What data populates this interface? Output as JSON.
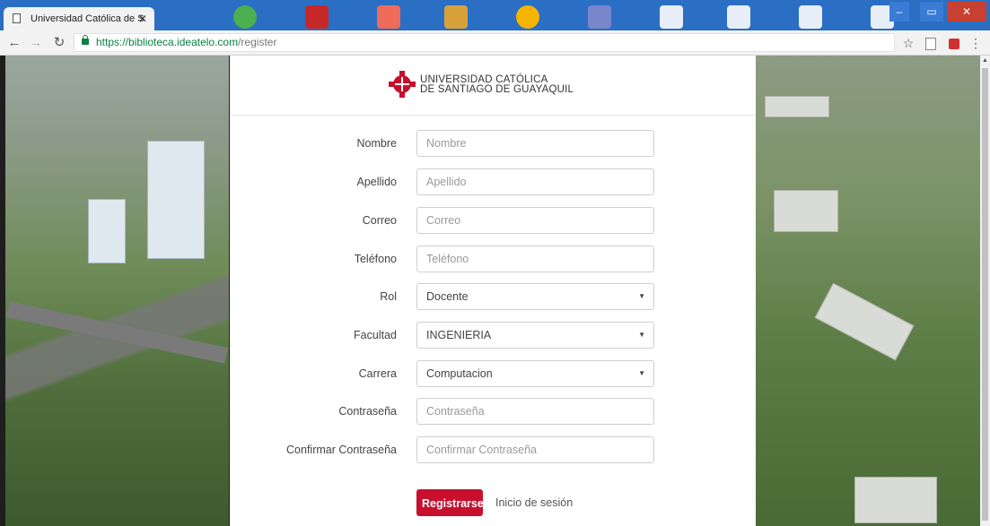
{
  "browser": {
    "tab_title": "Universidad Católica de S",
    "url_host": "https://biblioteca.ideatelo.com",
    "url_path": "/register"
  },
  "logo": {
    "line1": "UNIVERSIDAD CATÓLICA",
    "line2": "DE SANTIAGO DE GUAYAQUIL",
    "color": "#c8102e"
  },
  "form": {
    "fields": [
      {
        "label": "Nombre",
        "placeholder": "Nombre"
      },
      {
        "label": "Apellido",
        "placeholder": "Apellido"
      },
      {
        "label": "Correo",
        "placeholder": "Correo"
      },
      {
        "label": "Teléfono",
        "placeholder": "Teléfono"
      },
      {
        "label": "Rol",
        "value": "Docente"
      },
      {
        "label": "Facultad",
        "value": "INGENIERIA"
      },
      {
        "label": "Carrera",
        "value": "Computacion"
      },
      {
        "label": "Contraseña",
        "placeholder": "Contraseña"
      },
      {
        "label": "Confirmar Contraseña",
        "placeholder": "Confirmar Contraseña"
      }
    ],
    "submit_label": "Registrarse",
    "login_link": "Inicio de sesión"
  },
  "colors": {
    "accent": "#c8102e",
    "tab_bar": "#2a6fc4"
  }
}
